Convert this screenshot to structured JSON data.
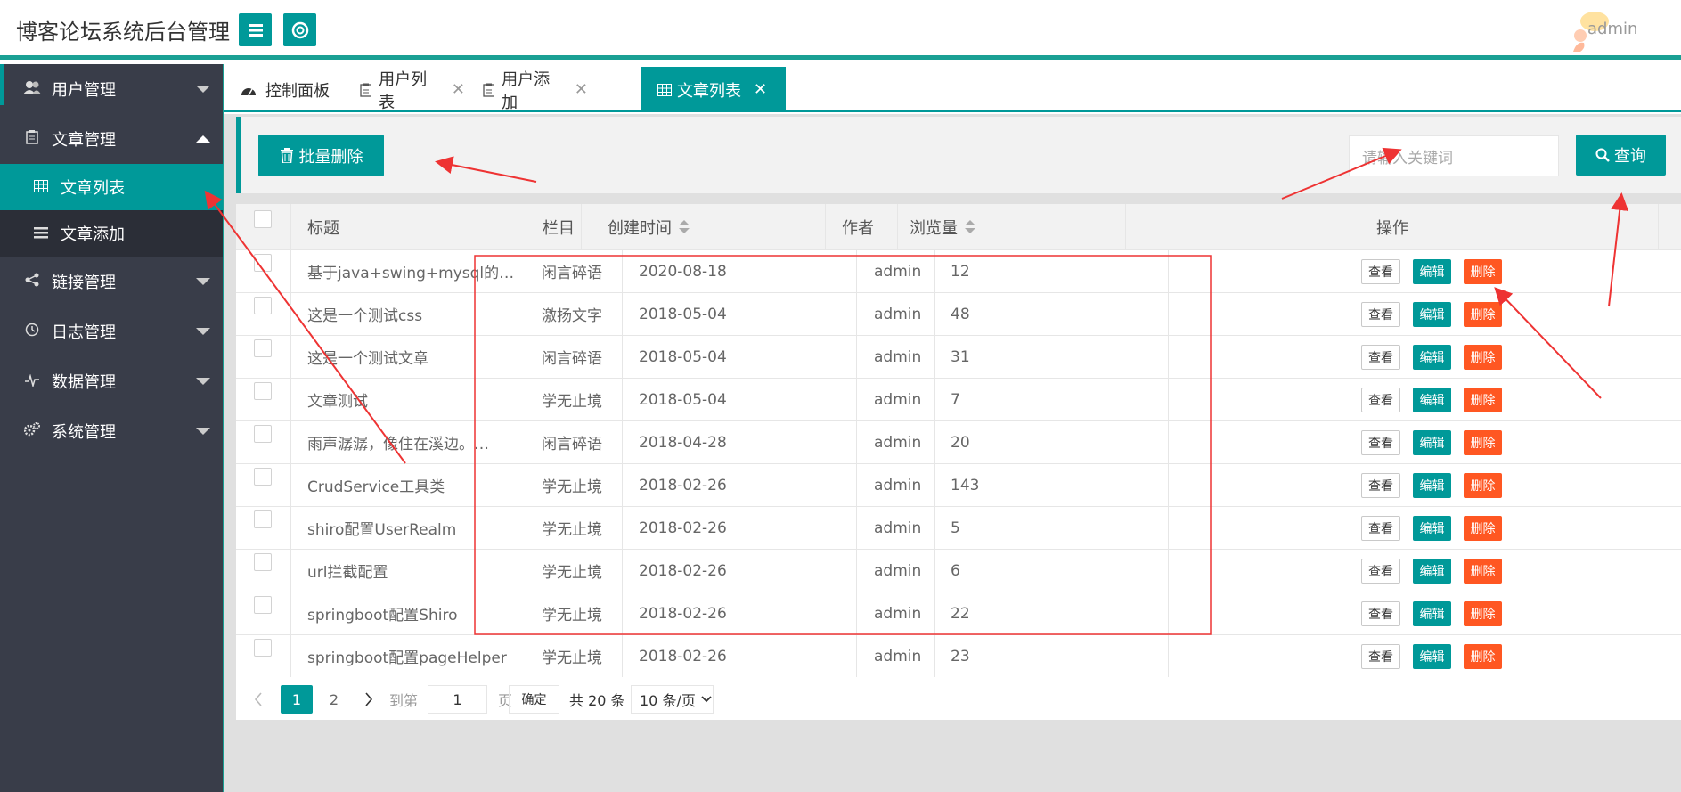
{
  "header": {
    "title": "博客论坛系统后台管理",
    "user": "admin"
  },
  "sidebar": {
    "items": [
      {
        "label": "用户管理",
        "icon": "users-icon"
      },
      {
        "label": "文章管理",
        "icon": "document-icon"
      },
      {
        "label": "文章列表",
        "icon": "table-icon"
      },
      {
        "label": "文章添加",
        "icon": "list-icon"
      },
      {
        "label": "链接管理",
        "icon": "share-icon"
      },
      {
        "label": "日志管理",
        "icon": "history-icon"
      },
      {
        "label": "数据管理",
        "icon": "pulse-icon"
      },
      {
        "label": "系统管理",
        "icon": "gears-icon"
      }
    ]
  },
  "tabs": [
    {
      "label": "控制面板",
      "icon": "dashboard-icon"
    },
    {
      "label": "用户列表",
      "icon": "clipboard-icon"
    },
    {
      "label": "用户添加",
      "icon": "clipboard-icon"
    },
    {
      "label": "文章列表",
      "icon": "table-icon"
    }
  ],
  "toolbar": {
    "batch_delete": "批量删除",
    "search_placeholder": "请输入关键词",
    "search_label": "查询"
  },
  "table": {
    "headers": [
      "标题",
      "栏目",
      "创建时间",
      "作者",
      "浏览量",
      "操作"
    ],
    "rows": [
      [
        "基于java+swing+mysql的…",
        "闲言碎语",
        "2020-08-18",
        "admin",
        "12"
      ],
      [
        "这是一个测试css",
        "激扬文字",
        "2018-05-04",
        "admin",
        "48"
      ],
      [
        "这是一个测试文章",
        "闲言碎语",
        "2018-05-04",
        "admin",
        "31"
      ],
      [
        "文章测试",
        "学无止境",
        "2018-05-04",
        "admin",
        "7"
      ],
      [
        "雨声潺潺，像住在溪边。…",
        "闲言碎语",
        "2018-04-28",
        "admin",
        "20"
      ],
      [
        "CrudService工具类",
        "学无止境",
        "2018-02-26",
        "admin",
        "143"
      ],
      [
        "shiro配置UserRealm",
        "学无止境",
        "2018-02-26",
        "admin",
        "5"
      ],
      [
        "url拦截配置",
        "学无止境",
        "2018-02-26",
        "admin",
        "6"
      ],
      [
        "springboot配置Shiro",
        "学无止境",
        "2018-02-26",
        "admin",
        "22"
      ],
      [
        "springboot配置pageHelper",
        "学无止境",
        "2018-02-26",
        "admin",
        "23"
      ]
    ],
    "ops": {
      "view": "查看",
      "edit": "编辑",
      "delete": "删除"
    }
  },
  "pager": {
    "page1": "1",
    "page2": "2",
    "goto": "到第",
    "goto_value": "1",
    "page_unit": "页",
    "confirm": "确定",
    "total": "共 20 条",
    "per_page": "10 条/页"
  },
  "colors": {
    "accent": "#009999",
    "danger": "#ff5722",
    "sidebar": "#393d49"
  }
}
